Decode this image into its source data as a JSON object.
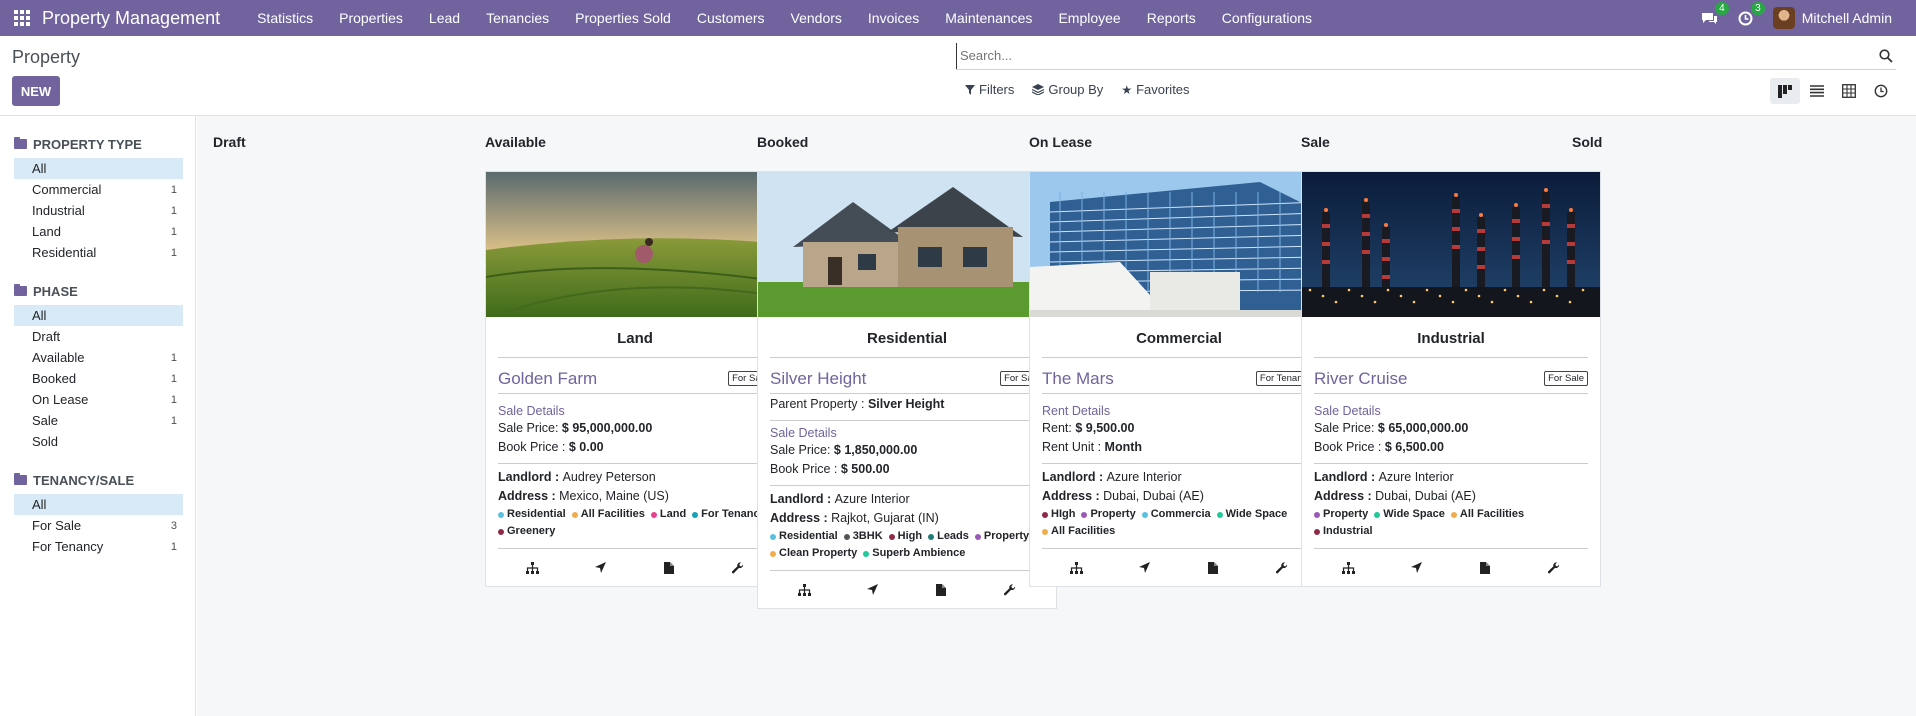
{
  "app": {
    "brand": "Property Management",
    "menu": [
      "Statistics",
      "Properties",
      "Lead",
      "Tenancies",
      "Properties Sold",
      "Customers",
      "Vendors",
      "Invoices",
      "Maintenances",
      "Employee",
      "Reports",
      "Configurations"
    ],
    "messages_badge": "4",
    "activities_badge": "3",
    "user": "Mitchell Admin",
    "accent_color": "#71639e"
  },
  "control": {
    "title": "Property",
    "new_label": "NEW",
    "search_placeholder": "Search...",
    "filters_label": "Filters",
    "groupby_label": "Group By",
    "favorites_label": "Favorites"
  },
  "sidebar": {
    "groups": [
      {
        "title": "PROPERTY TYPE",
        "items": [
          {
            "label": "All",
            "count": "",
            "selected": true
          },
          {
            "label": "Commercial",
            "count": "1"
          },
          {
            "label": "Industrial",
            "count": "1"
          },
          {
            "label": "Land",
            "count": "1"
          },
          {
            "label": "Residential",
            "count": "1"
          }
        ]
      },
      {
        "title": "PHASE",
        "items": [
          {
            "label": "All",
            "count": "",
            "selected": true
          },
          {
            "label": "Draft",
            "count": ""
          },
          {
            "label": "Available",
            "count": "1"
          },
          {
            "label": "Booked",
            "count": "1"
          },
          {
            "label": "On Lease",
            "count": "1"
          },
          {
            "label": "Sale",
            "count": "1"
          },
          {
            "label": "Sold",
            "count": ""
          }
        ]
      },
      {
        "title": "TENANCY/SALE",
        "items": [
          {
            "label": "All",
            "count": "",
            "selected": true
          },
          {
            "label": "For Sale",
            "count": "3"
          },
          {
            "label": "For Tenancy",
            "count": "1"
          }
        ]
      }
    ]
  },
  "columns": [
    "Draft",
    "Available",
    "Booked",
    "On Lease",
    "Sale",
    "Sold"
  ],
  "cards": [
    {
      "column": "Available",
      "image": "field",
      "category": "Land",
      "name": "Golden Farm",
      "badge": "For Sale",
      "sections": [
        {
          "heading": "Sale Details",
          "lines": [
            [
              "Sale Price: ",
              "$ 95,000,000.00"
            ],
            [
              "Book Price : ",
              "$ 0.00"
            ]
          ]
        }
      ],
      "landlord": "Audrey Peterson",
      "address": "Mexico, Maine (US)",
      "tags": [
        {
          "label": "Residential",
          "color": "#5bc0de"
        },
        {
          "label": "All Facilities",
          "color": "#f0ad4e"
        },
        {
          "label": "Land",
          "color": "#e83e8c"
        },
        {
          "label": "For Tenancy",
          "color": "#17a2b8"
        },
        {
          "label": "Greenery",
          "color": "#8e2c48"
        }
      ]
    },
    {
      "column": "Booked",
      "image": "house",
      "category": "Residential",
      "name": "Silver Height",
      "badge": "For Sale",
      "parent_label": "Parent Property : ",
      "parent_value": "Silver Height",
      "sections": [
        {
          "heading": "Sale Details",
          "lines": [
            [
              "Sale Price: ",
              "$ 1,850,000.00"
            ],
            [
              "Book Price : ",
              "$ 500.00"
            ]
          ]
        }
      ],
      "landlord": "Azure Interior",
      "address": "Rajkot, Gujarat (IN)",
      "tags": [
        {
          "label": "Residential",
          "color": "#5bc0de"
        },
        {
          "label": "3BHK",
          "color": "#555"
        },
        {
          "label": "High",
          "color": "#8e2c48"
        },
        {
          "label": "Leads",
          "color": "#1e7e74"
        },
        {
          "label": "Property",
          "color": "#9b59b6"
        },
        {
          "label": "Clean Property",
          "color": "#f0ad4e"
        },
        {
          "label": "Superb Ambience",
          "color": "#20c997"
        }
      ]
    },
    {
      "column": "On Lease",
      "image": "office",
      "category": "Commercial",
      "name": "The Mars",
      "badge": "For Tenancy",
      "sections": [
        {
          "heading": "Rent Details",
          "lines": [
            [
              "Rent: ",
              "$ 9,500.00"
            ],
            [
              "Rent Unit : ",
              "Month"
            ]
          ]
        }
      ],
      "landlord": "Azure Interior",
      "address": "Dubai, Dubai (AE)",
      "tags": [
        {
          "label": "HIgh",
          "color": "#8e2c48"
        },
        {
          "label": "Property",
          "color": "#9b59b6"
        },
        {
          "label": "Commercia",
          "color": "#5bc0de"
        },
        {
          "label": "Wide Space",
          "color": "#20c997"
        },
        {
          "label": "All Facilities",
          "color": "#f0ad4e"
        }
      ]
    },
    {
      "column": "Sale",
      "image": "industry",
      "category": "Industrial",
      "name": "River Cruise",
      "badge": "For Sale",
      "sections": [
        {
          "heading": "Sale Details",
          "lines": [
            [
              "Sale Price: ",
              "$ 65,000,000.00"
            ],
            [
              "Book Price : ",
              "$ 6,500.00"
            ]
          ]
        }
      ],
      "landlord": "Azure Interior",
      "address": "Dubai, Dubai (AE)",
      "tags": [
        {
          "label": "Property",
          "color": "#9b59b6"
        },
        {
          "label": "Wide Space",
          "color": "#20c997"
        },
        {
          "label": "All Facilities",
          "color": "#f0ad4e"
        },
        {
          "label": "Industrial",
          "color": "#8e2c48"
        }
      ]
    }
  ],
  "labels": {
    "landlord": "Landlord : ",
    "address": "Address : "
  }
}
